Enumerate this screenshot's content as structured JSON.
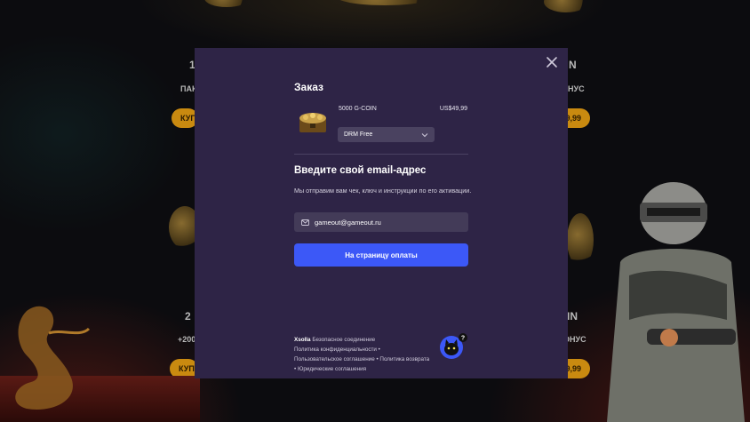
{
  "background": {
    "left_texts": [
      "1",
      "ПАК",
      "2",
      "+200"
    ],
    "right_texts": [
      "N",
      "НУС",
      "IN",
      "ОНУС"
    ],
    "left_buttons": [
      "КУП",
      "КУП"
    ],
    "right_buttons": [
      "9,99",
      "9,99"
    ]
  },
  "modal": {
    "title": "Заказ",
    "product": {
      "name": "5000 G-COIN",
      "price": "US$49,99",
      "platform_selected": "DRM Free"
    },
    "email_section": {
      "title": "Введите свой email-адрес",
      "description": "Мы отправим вам чек, ключ и инструкции по его активации.",
      "email_value": "gameout@gameout.ru"
    },
    "pay_button": "На страницу оплаты",
    "footer": {
      "brand": "Xsolla",
      "secure": "Безопасное соединение",
      "privacy": "Политика конфиденциальности",
      "user_agreement": "Пользовательское соглашение",
      "refund": "Политика возврата",
      "legal": "Юридические соглашения",
      "sep": " • "
    }
  },
  "colors": {
    "modal_bg": "#2e2446",
    "accent": "#3c58f7",
    "field_bg": "#433b58",
    "bg_button": "#c98a10"
  },
  "icons": [
    "close-icon",
    "chevron-down-icon",
    "email-icon",
    "support-bot-icon",
    "gold-chest-icon"
  ]
}
